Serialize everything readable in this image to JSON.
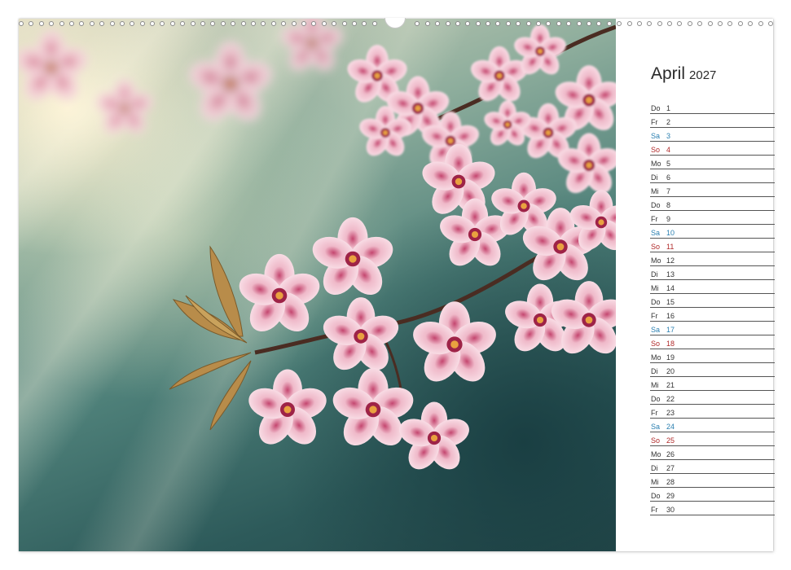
{
  "calendar": {
    "month": "April",
    "year": "2027",
    "days": [
      {
        "weekday": "Do",
        "day": "1",
        "type": "weekday"
      },
      {
        "weekday": "Fr",
        "day": "2",
        "type": "weekday"
      },
      {
        "weekday": "Sa",
        "day": "3",
        "type": "saturday"
      },
      {
        "weekday": "So",
        "day": "4",
        "type": "sunday"
      },
      {
        "weekday": "Mo",
        "day": "5",
        "type": "weekday"
      },
      {
        "weekday": "Di",
        "day": "6",
        "type": "weekday"
      },
      {
        "weekday": "Mi",
        "day": "7",
        "type": "weekday"
      },
      {
        "weekday": "Do",
        "day": "8",
        "type": "weekday"
      },
      {
        "weekday": "Fr",
        "day": "9",
        "type": "weekday"
      },
      {
        "weekday": "Sa",
        "day": "10",
        "type": "saturday"
      },
      {
        "weekday": "So",
        "day": "11",
        "type": "sunday"
      },
      {
        "weekday": "Mo",
        "day": "12",
        "type": "weekday"
      },
      {
        "weekday": "Di",
        "day": "13",
        "type": "weekday"
      },
      {
        "weekday": "Mi",
        "day": "14",
        "type": "weekday"
      },
      {
        "weekday": "Do",
        "day": "15",
        "type": "weekday"
      },
      {
        "weekday": "Fr",
        "day": "16",
        "type": "weekday"
      },
      {
        "weekday": "Sa",
        "day": "17",
        "type": "saturday"
      },
      {
        "weekday": "So",
        "day": "18",
        "type": "sunday"
      },
      {
        "weekday": "Mo",
        "day": "19",
        "type": "weekday"
      },
      {
        "weekday": "Di",
        "day": "20",
        "type": "weekday"
      },
      {
        "weekday": "Mi",
        "day": "21",
        "type": "weekday"
      },
      {
        "weekday": "Do",
        "day": "22",
        "type": "weekday"
      },
      {
        "weekday": "Fr",
        "day": "23",
        "type": "weekday"
      },
      {
        "weekday": "Sa",
        "day": "24",
        "type": "saturday"
      },
      {
        "weekday": "So",
        "day": "25",
        "type": "sunday"
      },
      {
        "weekday": "Mo",
        "day": "26",
        "type": "weekday"
      },
      {
        "weekday": "Di",
        "day": "27",
        "type": "weekday"
      },
      {
        "weekday": "Mi",
        "day": "28",
        "type": "weekday"
      },
      {
        "weekday": "Do",
        "day": "29",
        "type": "weekday"
      },
      {
        "weekday": "Fr",
        "day": "30",
        "type": "weekday"
      }
    ]
  },
  "colors": {
    "saturday": "#2a7fb0",
    "sunday": "#b02a2a",
    "weekday": "#333333",
    "blossom": "#f3d3dc",
    "blossom_center": "#a3284f"
  },
  "photo": {
    "subject": "cherry-blossom-branch"
  }
}
